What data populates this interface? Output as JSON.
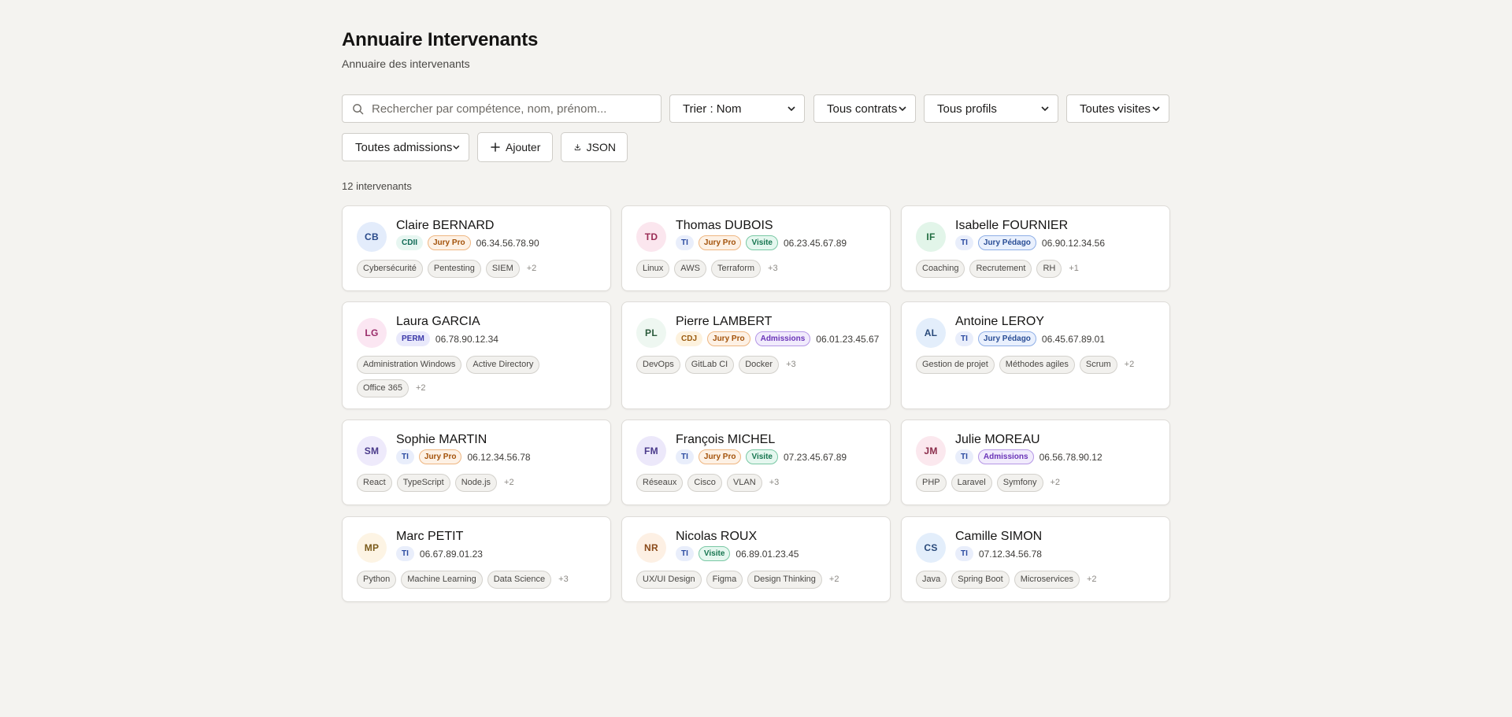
{
  "header": {
    "title": "Annuaire Intervenants",
    "subtitle": "Annuaire des intervenants"
  },
  "filters": {
    "search_placeholder": "Rechercher par compétence, nom, prénom...",
    "sort": "Trier : Nom",
    "contract": "Tous contrats",
    "profile": "Tous profils",
    "visit": "Toutes visites",
    "admission": "Toutes admissions",
    "add_label": "Ajouter",
    "json_label": "JSON"
  },
  "count_label": "12 intervenants",
  "colors": {
    "background": "#f4f3f0",
    "card": "#ffffff",
    "jury_pro": "#a3520a",
    "visite": "#16754f",
    "admissions": "#6a34b8",
    "jury_pedago": "#2a4e96"
  },
  "cards": [
    {
      "initials": "CB",
      "name": "Claire BERNARD",
      "badges": [
        {
          "label": "CDII",
          "kind": "cdii"
        },
        {
          "label": "Jury Pro",
          "kind": "jury-pro"
        }
      ],
      "phone": "06.34.56.78.90",
      "tags": [
        "Cybersécurité",
        "Pentesting",
        "SIEM"
      ],
      "more": "+2",
      "avatar_bg": "#e3ecfb",
      "avatar_fg": "#2a4a8a"
    },
    {
      "initials": "TD",
      "name": "Thomas DUBOIS",
      "badges": [
        {
          "label": "TI",
          "kind": "ti"
        },
        {
          "label": "Jury Pro",
          "kind": "jury-pro"
        },
        {
          "label": "Visite",
          "kind": "visite"
        }
      ],
      "phone": "06.23.45.67.89",
      "tags": [
        "Linux",
        "AWS",
        "Terraform"
      ],
      "more": "+3",
      "avatar_bg": "#fbe6ee",
      "avatar_fg": "#9a2c54"
    },
    {
      "initials": "IF",
      "name": "Isabelle FOURNIER",
      "badges": [
        {
          "label": "TI",
          "kind": "ti"
        },
        {
          "label": "Jury Pédago",
          "kind": "jury-pedago"
        }
      ],
      "phone": "06.90.12.34.56",
      "tags": [
        "Coaching",
        "Recrutement",
        "RH"
      ],
      "more": "+1",
      "avatar_bg": "#e2f5e9",
      "avatar_fg": "#1f6b3f"
    },
    {
      "initials": "LG",
      "name": "Laura GARCIA",
      "badges": [
        {
          "label": "PERM",
          "kind": "perm"
        }
      ],
      "phone": "06.78.90.12.34",
      "tags": [
        "Administration Windows",
        "Active Directory",
        "Office 365"
      ],
      "more": "+2",
      "avatar_bg": "#fbe6f2",
      "avatar_fg": "#9a2c6a"
    },
    {
      "initials": "PL",
      "name": "Pierre LAMBERT",
      "badges": [
        {
          "label": "CDJ",
          "kind": "cdj"
        },
        {
          "label": "Jury Pro",
          "kind": "jury-pro"
        },
        {
          "label": "Admissions",
          "kind": "admissions"
        }
      ],
      "phone": "06.01.23.45.67",
      "tags": [
        "DevOps",
        "GitLab CI",
        "Docker"
      ],
      "more": "+3",
      "avatar_bg": "#eef7f1",
      "avatar_fg": "#2a5a3b"
    },
    {
      "initials": "AL",
      "name": "Antoine LEROY",
      "badges": [
        {
          "label": "TI",
          "kind": "ti"
        },
        {
          "label": "Jury Pédago",
          "kind": "jury-pedago"
        }
      ],
      "phone": "06.45.67.89.01",
      "tags": [
        "Gestion de projet",
        "Méthodes agiles",
        "Scrum"
      ],
      "more": "+2",
      "avatar_bg": "#e3eefb",
      "avatar_fg": "#2a4a7a"
    },
    {
      "initials": "SM",
      "name": "Sophie MARTIN",
      "badges": [
        {
          "label": "TI",
          "kind": "ti"
        },
        {
          "label": "Jury Pro",
          "kind": "jury-pro"
        }
      ],
      "phone": "06.12.34.56.78",
      "tags": [
        "React",
        "TypeScript",
        "Node.js"
      ],
      "more": "+2",
      "avatar_bg": "#eeeafb",
      "avatar_fg": "#4a3a8a"
    },
    {
      "initials": "FM",
      "name": "François MICHEL",
      "badges": [
        {
          "label": "TI",
          "kind": "ti"
        },
        {
          "label": "Jury Pro",
          "kind": "jury-pro"
        },
        {
          "label": "Visite",
          "kind": "visite"
        }
      ],
      "phone": "07.23.45.67.89",
      "tags": [
        "Réseaux",
        "Cisco",
        "VLAN"
      ],
      "more": "+3",
      "avatar_bg": "#ece8fa",
      "avatar_fg": "#4a3a8a"
    },
    {
      "initials": "JM",
      "name": "Julie MOREAU",
      "badges": [
        {
          "label": "TI",
          "kind": "ti"
        },
        {
          "label": "Admissions",
          "kind": "admissions"
        }
      ],
      "phone": "06.56.78.90.12",
      "tags": [
        "PHP",
        "Laravel",
        "Symfony"
      ],
      "more": "+2",
      "avatar_bg": "#fbe8ee",
      "avatar_fg": "#8a2c4a"
    },
    {
      "initials": "MP",
      "name": "Marc PETIT",
      "badges": [
        {
          "label": "TI",
          "kind": "ti"
        }
      ],
      "phone": "06.67.89.01.23",
      "tags": [
        "Python",
        "Machine Learning",
        "Data Science"
      ],
      "more": "+3",
      "avatar_bg": "#fdf4e4",
      "avatar_fg": "#7a5a1a"
    },
    {
      "initials": "NR",
      "name": "Nicolas ROUX",
      "badges": [
        {
          "label": "TI",
          "kind": "ti"
        },
        {
          "label": "Visite",
          "kind": "visite"
        }
      ],
      "phone": "06.89.01.23.45",
      "tags": [
        "UX/UI Design",
        "Figma",
        "Design Thinking"
      ],
      "more": "+2",
      "avatar_bg": "#fdf0e4",
      "avatar_fg": "#8a4a1a"
    },
    {
      "initials": "CS",
      "name": "Camille SIMON",
      "badges": [
        {
          "label": "TI",
          "kind": "ti"
        }
      ],
      "phone": "07.12.34.56.78",
      "tags": [
        "Java",
        "Spring Boot",
        "Microservices"
      ],
      "more": "+2",
      "avatar_bg": "#e3eefb",
      "avatar_fg": "#2a4a7a"
    }
  ]
}
